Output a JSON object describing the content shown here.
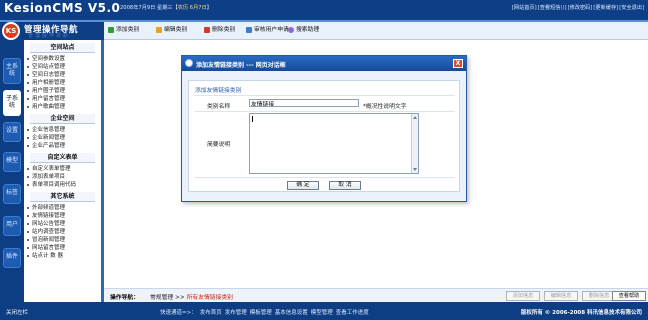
{
  "header": {
    "product": "KesionCMS V5.0",
    "date": "2008年7月9日 星期三【农历 6月7日】",
    "lunar_prefix": "2008年7月9日 星期三【",
    "lunar": "农历 6月7日",
    "lunar_suffix": "】",
    "links": [
      "[网站首页]",
      "[查看短信",
      "()",
      "]",
      "[修改密码]",
      "[更新缓存]",
      "[安全退出]"
    ]
  },
  "logo": {
    "badge": "KS",
    "text": "管理操作导航",
    "shadow": "管理操作导航"
  },
  "vtabs": [
    "主系统",
    "子系统",
    "设置",
    "模型",
    "标签",
    "用户",
    "插件"
  ],
  "sidebar": {
    "sections": [
      {
        "title": "空间站点",
        "items": [
          "空间参数设置",
          "空间站点管理",
          "空间日志管理",
          "用户相册管理",
          "用户圈子管理",
          "用户留言管理",
          "用户歌曲管理"
        ]
      },
      {
        "title": "企业空间",
        "items": [
          "企业信息管理",
          "企业新闻管理",
          "企业产品管理"
        ]
      },
      {
        "title": "自定义表单",
        "items": [
          "自定义表单管理",
          "添加表单项目",
          "表单项目调用代码"
        ]
      },
      {
        "title": "其它系统",
        "items": [
          "外部频道管理",
          "友情链接管理",
          "网站公告管理",
          "站内调查管理",
          "冒泡新闻管理",
          "网站留言管理",
          "站点计 数 器"
        ]
      }
    ]
  },
  "toolbar": {
    "buttons": [
      "添加类别",
      "编辑类别",
      "删除类别",
      "审核用户申请",
      "搜索助理"
    ]
  },
  "dialog": {
    "title": "添加友情链接类别 --- 网页对话框",
    "close": "X",
    "form_caption": "添加友情链接类别",
    "name_label": "类别名称",
    "name_value": "友情链接",
    "name_hint": "*概况性说明文字",
    "desc_label": "简要说明",
    "confirm": "确 定",
    "cancel": "取 消"
  },
  "nav": {
    "label": "操作导航：",
    "path": "常规管理 >> ",
    "current": "所有友情链接类别",
    "buttons": [
      "添加信息",
      "编辑信息",
      "删除信息",
      "查看帮助"
    ]
  },
  "footer": {
    "close_left": "关闭左栏",
    "quick_title": "快速通道=>：",
    "quick_links": [
      "发布首页",
      "发布管理",
      "模板管理",
      "基本信息设置",
      "模型管理",
      "查看工作进度"
    ],
    "copyright": "版权所有 © 2006-2008 科汛信息技术有限公司"
  }
}
